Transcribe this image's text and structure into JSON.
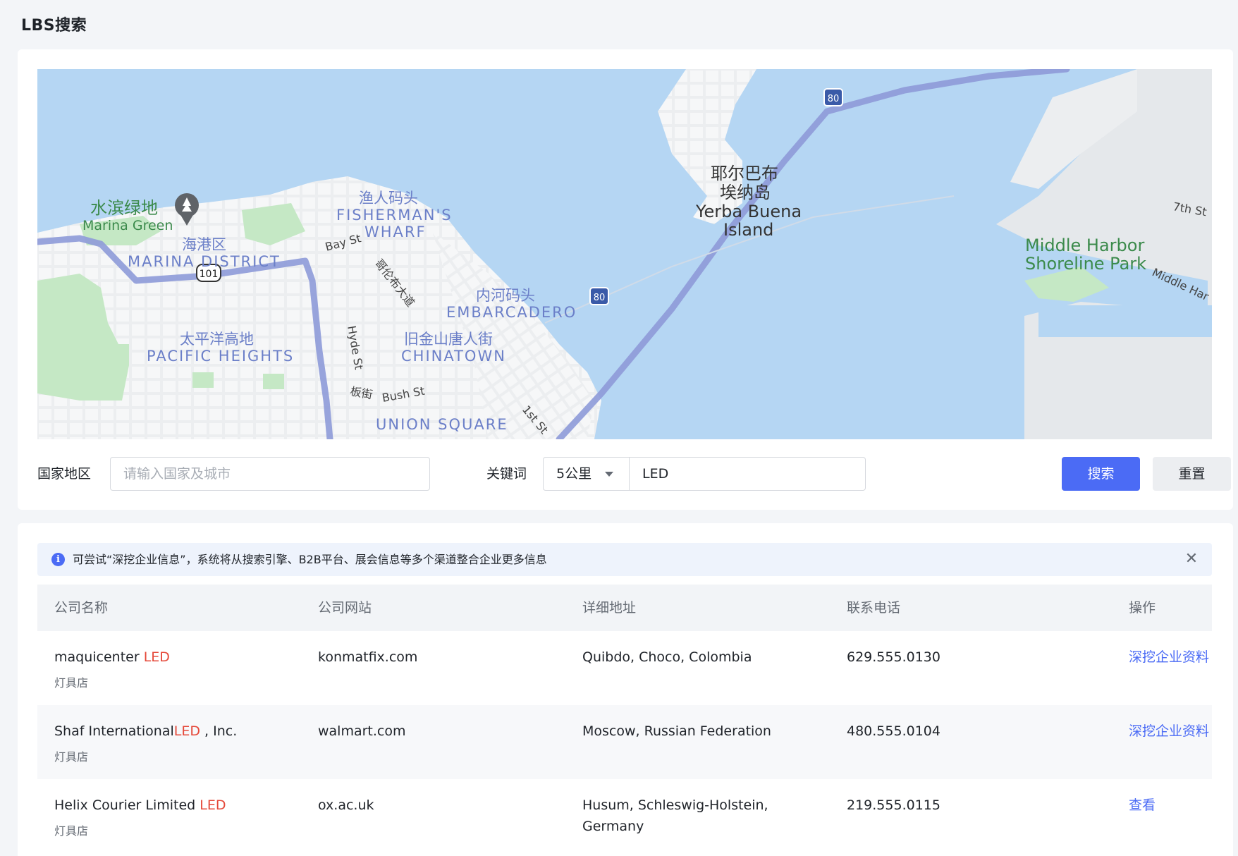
{
  "page": {
    "title": "LBS搜索"
  },
  "map": {
    "labels": {
      "marina_green_cn": "水滨绿地",
      "marina_green_en": "Marina Green",
      "marina_district_cn": "海港区",
      "marina_district_en": "MARINA DISTRICT",
      "fishermans_cn": "渔人码头",
      "fishermans_en1": "FISHERMAN'S",
      "fishermans_en2": "WHARF",
      "pacific_cn": "太平洋高地",
      "pacific_en": "PACIFIC HEIGHTS",
      "embarcadero_cn": "内河码头",
      "embarcadero_en": "EMBARCADERO",
      "chinatown_cn": "旧金山唐人街",
      "chinatown_en": "CHINATOWN",
      "union_square_en": "UNION SQUARE",
      "yerba_cn1": "耶尔巴布",
      "yerba_cn2": "埃纳岛",
      "yerba_en1": "Yerba Buena",
      "yerba_en2": "Island",
      "middle_harbor1": "Middle Harbor",
      "middle_harbor2": "Shoreline Park",
      "bay_st": "Bay St",
      "columbus_cn": "哥伦布大道",
      "hyde_st": "Hyde St",
      "bush_cn": "板街",
      "bush_st": "Bush St",
      "first_st": "1st St",
      "seventh_st": "7th St",
      "middle_harbor_rd": "Middle Har",
      "hwy_101": "101",
      "i80_a": "80",
      "i80_b": "80"
    }
  },
  "search": {
    "region_label": "国家地区",
    "region_placeholder": "请输入国家及城市",
    "keyword_label": "关键词",
    "radius_value": "5公里",
    "keyword_value": "LED",
    "search_button": "搜索",
    "reset_button": "重置"
  },
  "alert": {
    "text": "可尝试“深挖企业信息”，系统将从搜索引擎、B2B平台、展会信息等多个渠道整合企业更多信息"
  },
  "table": {
    "headers": [
      "公司名称",
      "公司网站",
      "详细地址",
      "联系电话",
      "操作"
    ],
    "rows": [
      {
        "name_pre": "maquicenter ",
        "name_hl": "LED",
        "name_post": "",
        "category": "灯具店",
        "website": "konmatfix.com",
        "address": "Quibdo, Choco, Colombia",
        "phone": "629.555.0130",
        "action": "深挖企业资料"
      },
      {
        "name_pre": "Shaf International",
        "name_hl": "LED",
        "name_post": " , Inc.",
        "category": "灯具店",
        "website": "walmart.com",
        "address": "Moscow, Russian Federation",
        "phone": "480.555.0104",
        "action": "深挖企业资料"
      },
      {
        "name_pre": "Helix Courier Limited ",
        "name_hl": "LED",
        "name_post": "",
        "category": "灯具店",
        "website": "ox.ac.uk",
        "address": "Husum, Schleswig-Holstein, Germany",
        "phone": "219.555.0115",
        "action": "查看"
      }
    ]
  },
  "colors": {
    "primary": "#4b6bf5",
    "highlight": "#e5493a",
    "water": "#b5d6f3",
    "land": "#f1f3f4",
    "park": "#c5e8c5",
    "route": "#8e9ad8"
  }
}
